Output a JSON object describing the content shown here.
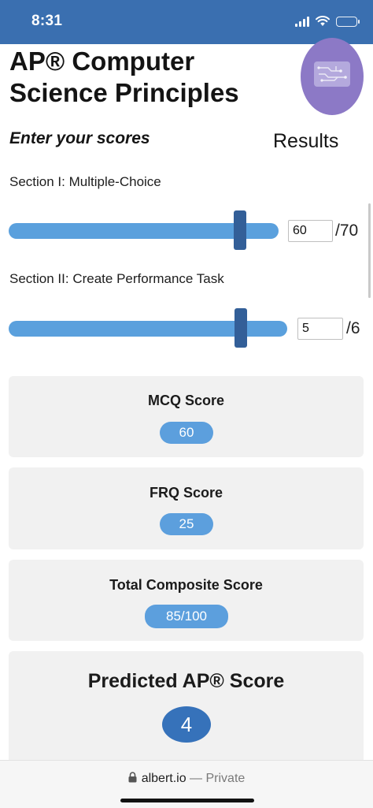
{
  "status_bar": {
    "time": "8:31"
  },
  "page": {
    "title": "AP® Computer Science Principles",
    "subtitle": "Enter your scores",
    "results_label": "Results"
  },
  "sections": [
    {
      "label": "Section I: Multiple-Choice",
      "value": "60",
      "max_label": "/70",
      "fraction": 0.857
    },
    {
      "label": "Section II: Create Performance Task",
      "value": "5",
      "max_label": "/6",
      "fraction": 0.833
    }
  ],
  "results": {
    "mcq": {
      "label": "MCQ Score",
      "value": "60"
    },
    "frq": {
      "label": "FRQ Score",
      "value": "25"
    },
    "composite": {
      "label": "Total Composite Score",
      "value": "85/100"
    },
    "predicted": {
      "label": "Predicted AP® Score",
      "value": "4"
    }
  },
  "browser": {
    "domain": "albert.io",
    "separator": " — ",
    "mode": "Private"
  },
  "colors": {
    "status_bar": "#3a6fb0",
    "slider_track": "#5aa0dd",
    "slider_thumb": "#335f98",
    "pill": "#5c9fdd",
    "pill_big": "#3672ba",
    "logo": "#8c79c6",
    "card_bg": "#f1f1f1"
  },
  "icons": [
    "signal-icon",
    "wifi-icon",
    "battery-icon",
    "circuit-logo-icon",
    "lock-icon"
  ]
}
